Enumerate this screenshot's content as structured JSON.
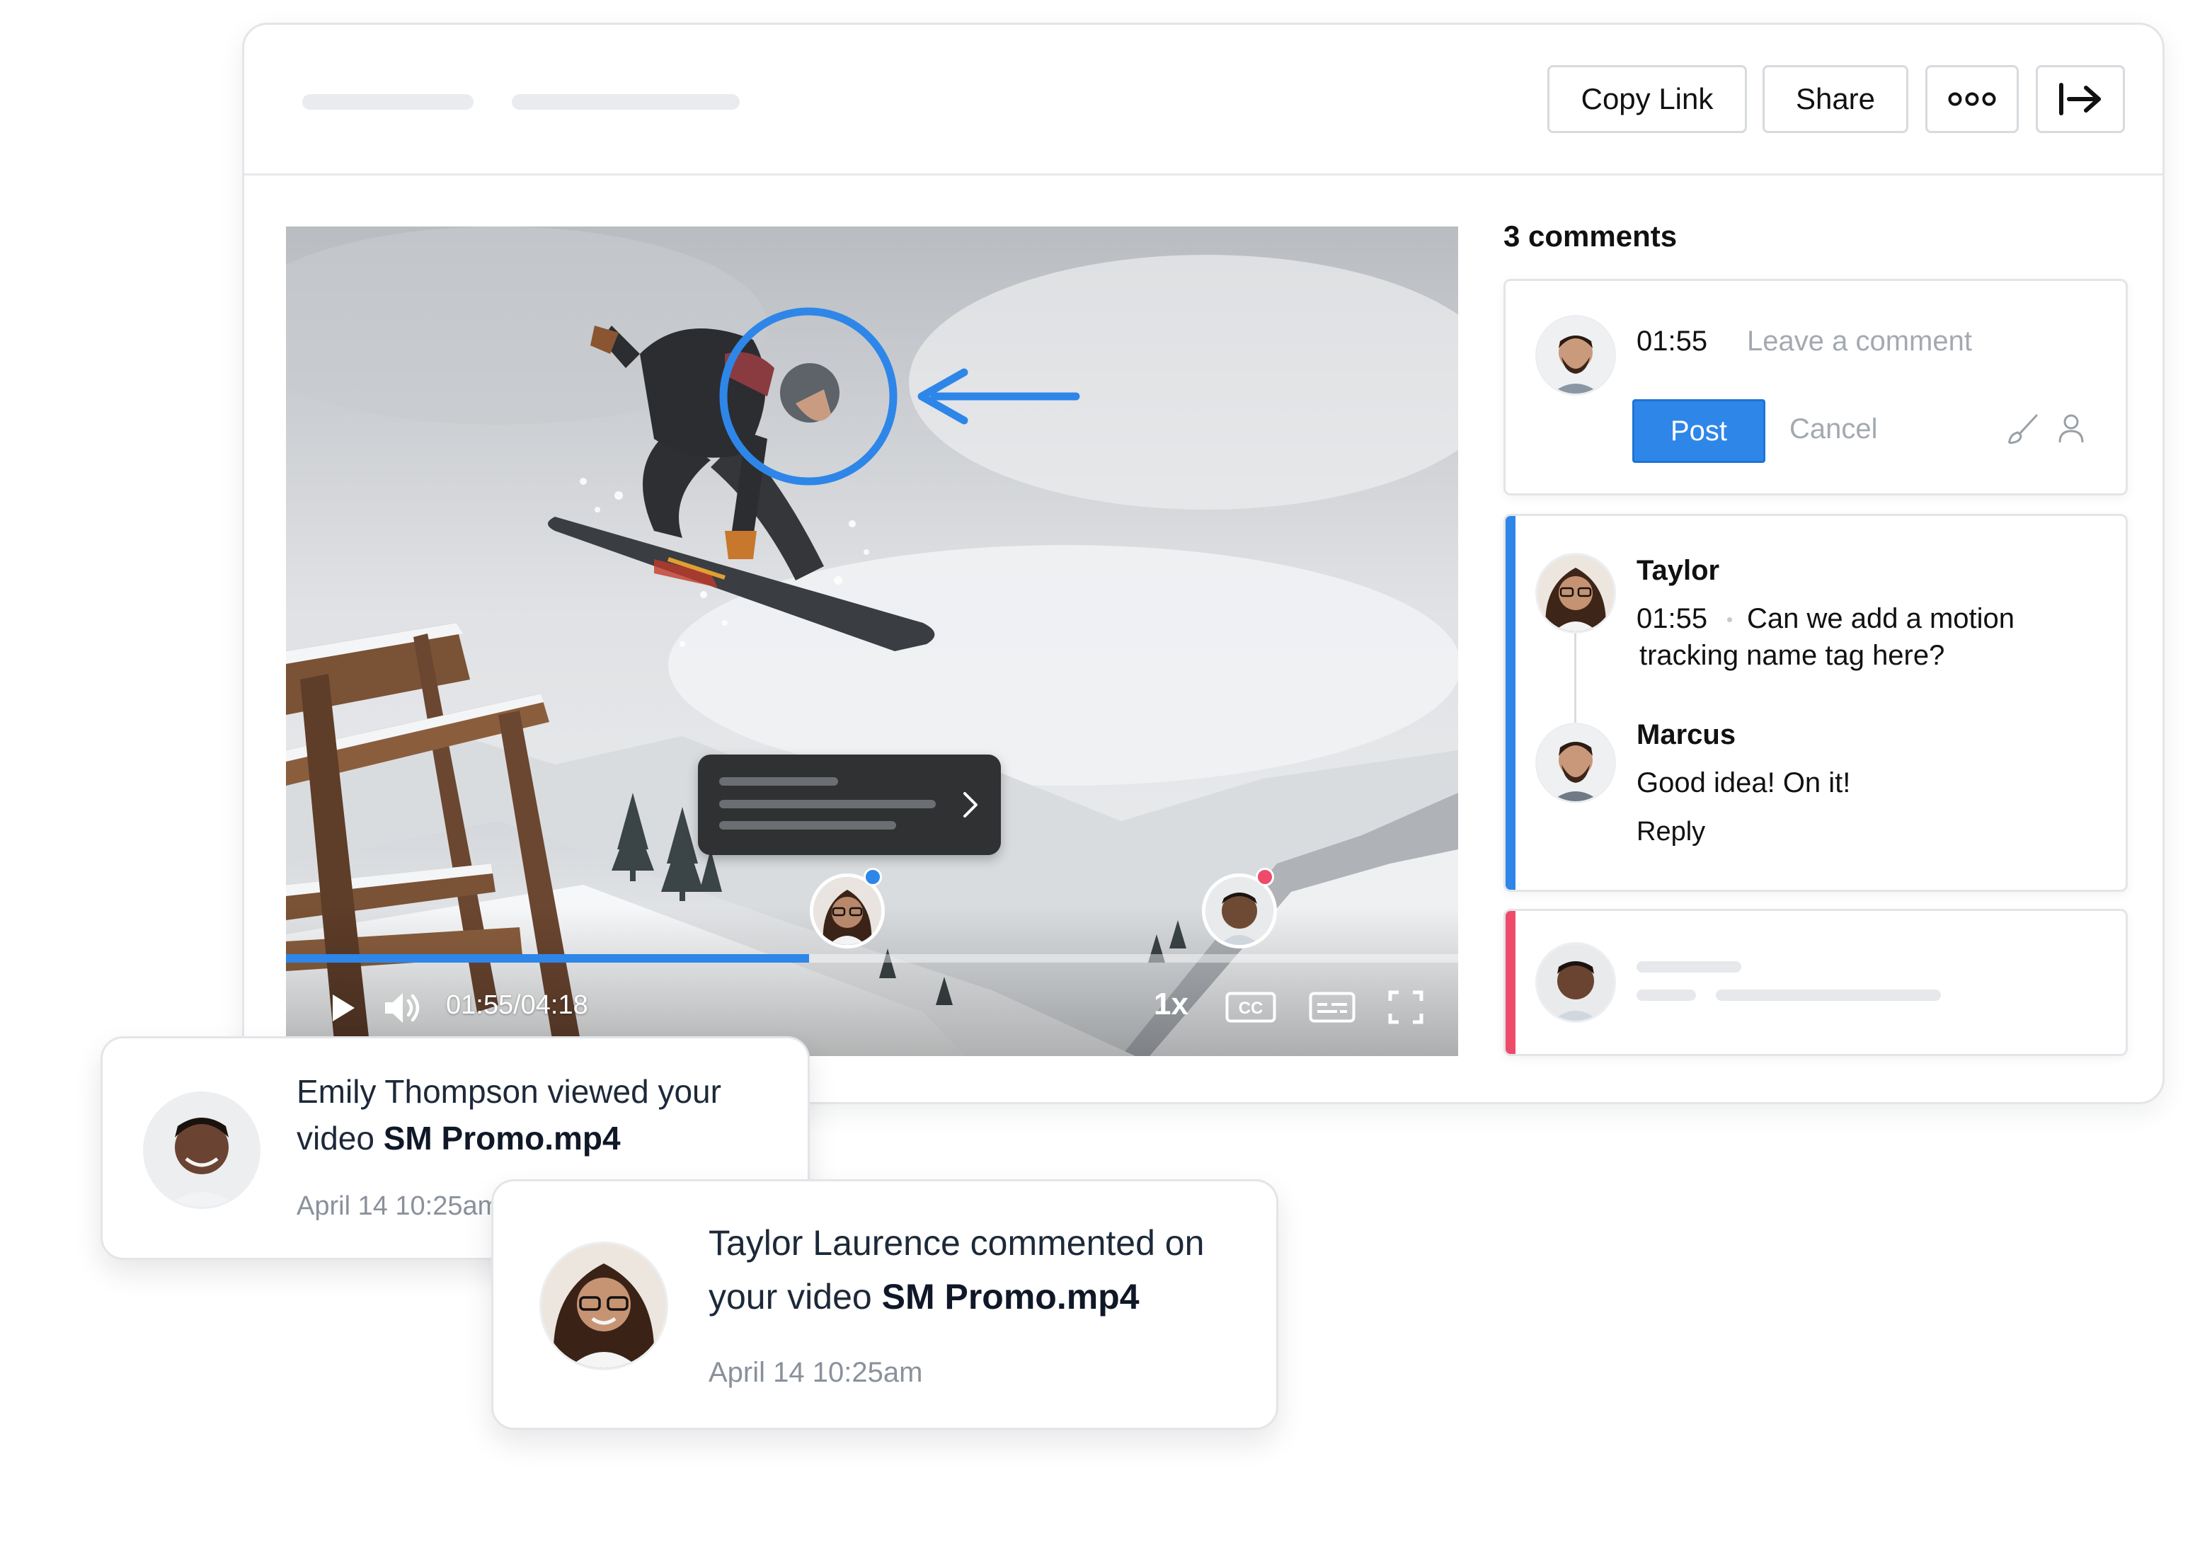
{
  "toolbar": {
    "copy_link": "Copy Link",
    "share": "Share",
    "more_icon": "ellipsis-icon",
    "exit_icon": "exit-arrow-icon"
  },
  "player": {
    "time": "01:55/04:18",
    "progress": 0.446,
    "speed": "1x",
    "annotation_color": "#2e86e8",
    "markers": [
      {
        "dot_color": "#2e86e8"
      },
      {
        "dot_color": "#ee4b6a"
      }
    ]
  },
  "comments": {
    "title": "3 comments",
    "composer": {
      "timestamp": "01:55",
      "placeholder": "Leave a comment",
      "post": "Post",
      "cancel": "Cancel"
    },
    "thread": {
      "accent": "#2e86e8",
      "author": "Taylor",
      "timestamp": "01:55",
      "text_line1": "Can we add a motion",
      "text_line2": "tracking name tag here?",
      "reply_author": "Marcus",
      "reply_text": "Good idea! On it!",
      "reply_link": "Reply"
    },
    "placeholder_accent": "#ee4b6a"
  },
  "notifications": [
    {
      "line1": "Emily Thompson viewed your",
      "line2_prefix": "video ",
      "file": "SM Promo.mp4",
      "time": "April 14 10:25am"
    },
    {
      "line1": "Taylor Laurence commented on",
      "line2_prefix": "your video ",
      "file": "SM Promo.mp4",
      "time": "April 14 10:25am"
    }
  ]
}
